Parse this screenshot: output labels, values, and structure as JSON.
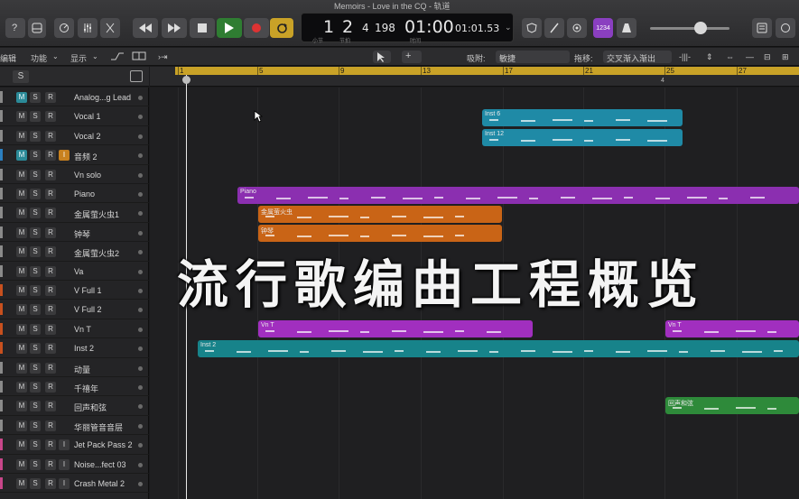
{
  "window": {
    "title": "Memoirs - Love in the CQ - 轨道"
  },
  "lcd": {
    "bar": "1",
    "beat": "2",
    "division": "4",
    "tick": "198",
    "time_main": "01:00",
    "time_sub": "01:01.53",
    "label_bar": "小节",
    "label_beat": "节拍",
    "label_time": "时间"
  },
  "key_badge": "1234",
  "toolbar": {
    "edit": "编辑",
    "functions": "功能",
    "view": "显示",
    "snap_label": "吸附:",
    "snap_value": "敏捷",
    "drag_label": "拖移:",
    "drag_value": "交叉渐入渐出"
  },
  "track_header": {
    "s_label": "S"
  },
  "ruler": {
    "marks": [
      "1",
      "5",
      "9",
      "13",
      "17",
      "21",
      "25",
      "27"
    ],
    "beat_marker": "4"
  },
  "tracks": [
    {
      "name": "Analog...g Lead",
      "m": "M",
      "s": "S",
      "r": "R",
      "color": "#8a8a8a",
      "monitor": true
    },
    {
      "name": "Vocal 1",
      "m": "M",
      "s": "S",
      "r": "R",
      "color": "#8a8a8a"
    },
    {
      "name": "Vocal 2",
      "m": "M",
      "s": "S",
      "r": "R",
      "color": "#8a8a8a"
    },
    {
      "name": "音频 2",
      "m": "M",
      "s": "S",
      "r": "R",
      "i": "I",
      "color": "#2b7fc0",
      "monitor": true,
      "input": true
    },
    {
      "name": "Vn solo",
      "m": "M",
      "s": "S",
      "r": "R",
      "color": "#8a8a8a"
    },
    {
      "name": "Piano",
      "m": "M",
      "s": "S",
      "r": "R",
      "color": "#8a8a8a"
    },
    {
      "name": "金属萤火虫1",
      "m": "M",
      "s": "S",
      "r": "R",
      "color": "#8a8a8a"
    },
    {
      "name": "钟琴",
      "m": "M",
      "s": "S",
      "r": "R",
      "color": "#8a8a8a"
    },
    {
      "name": "金属萤火虫2",
      "m": "M",
      "s": "S",
      "r": "R",
      "color": "#8a8a8a"
    },
    {
      "name": "Va",
      "m": "M",
      "s": "S",
      "r": "R",
      "color": "#8a8a8a"
    },
    {
      "name": "V Full 1",
      "m": "M",
      "s": "S",
      "r": "R",
      "color": "#c8501e"
    },
    {
      "name": "V Full 2",
      "m": "M",
      "s": "S",
      "r": "R",
      "color": "#c8501e"
    },
    {
      "name": "Vn T",
      "m": "M",
      "s": "S",
      "r": "R",
      "color": "#c8501e"
    },
    {
      "name": "Inst 2",
      "m": "M",
      "s": "S",
      "r": "R",
      "color": "#c8501e"
    },
    {
      "name": "动量",
      "m": "M",
      "s": "S",
      "r": "R",
      "color": "#8a8a8a"
    },
    {
      "name": "千禧年",
      "m": "M",
      "s": "S",
      "r": "R",
      "color": "#8a8a8a"
    },
    {
      "name": "回声和弦",
      "m": "M",
      "s": "S",
      "r": "R",
      "color": "#8a8a8a"
    },
    {
      "name": "华丽管音音层",
      "m": "M",
      "s": "S",
      "r": "R",
      "color": "#8a8a8a"
    },
    {
      "name": "Jet Pack Pass 2",
      "m": "M",
      "s": "S",
      "r": "R",
      "i": "I",
      "color": "#c8468a"
    },
    {
      "name": "Noise...fect 03",
      "m": "M",
      "s": "S",
      "r": "R",
      "i": "I",
      "color": "#c8468a"
    },
    {
      "name": "Crash Metal 2",
      "m": "M",
      "s": "S",
      "r": "R",
      "i": "I",
      "color": "#c8468a"
    }
  ],
  "regions": [
    {
      "label": "Inst 6",
      "color": "#1f8aa6"
    },
    {
      "label": "Inst 12",
      "color": "#1f8aa6"
    },
    {
      "label": "Piano",
      "color": "#8b2fb0"
    },
    {
      "label": "金属萤火虫",
      "color": "#c96416"
    },
    {
      "label": "钟琴",
      "color": "#c96416"
    },
    {
      "label": "Vn T",
      "color": "#a12fbf"
    },
    {
      "label": "Vn T",
      "color": "#a12fbf"
    },
    {
      "label": "Inst 2",
      "color": "#17838a"
    },
    {
      "label": "回声和弦",
      "color": "#2e8a3a"
    }
  ],
  "overlay_title": "流行歌编曲工程概览"
}
